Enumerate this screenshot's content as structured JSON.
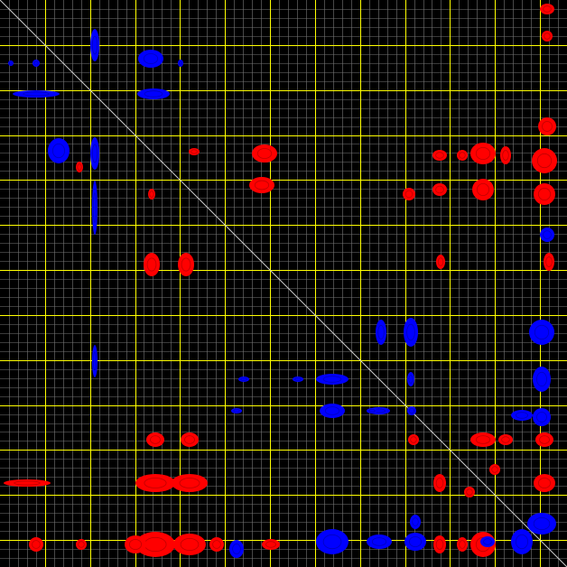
{
  "colors": {
    "background": "#000000",
    "minor_grid": "#777777",
    "major_grid": "#ffff00",
    "diagonal": "#cccccc",
    "positive_peak": "#ff0000",
    "negative_peak": "#0000ff"
  },
  "grid": {
    "minor_divisions": 63,
    "major_every": 5
  }
}
